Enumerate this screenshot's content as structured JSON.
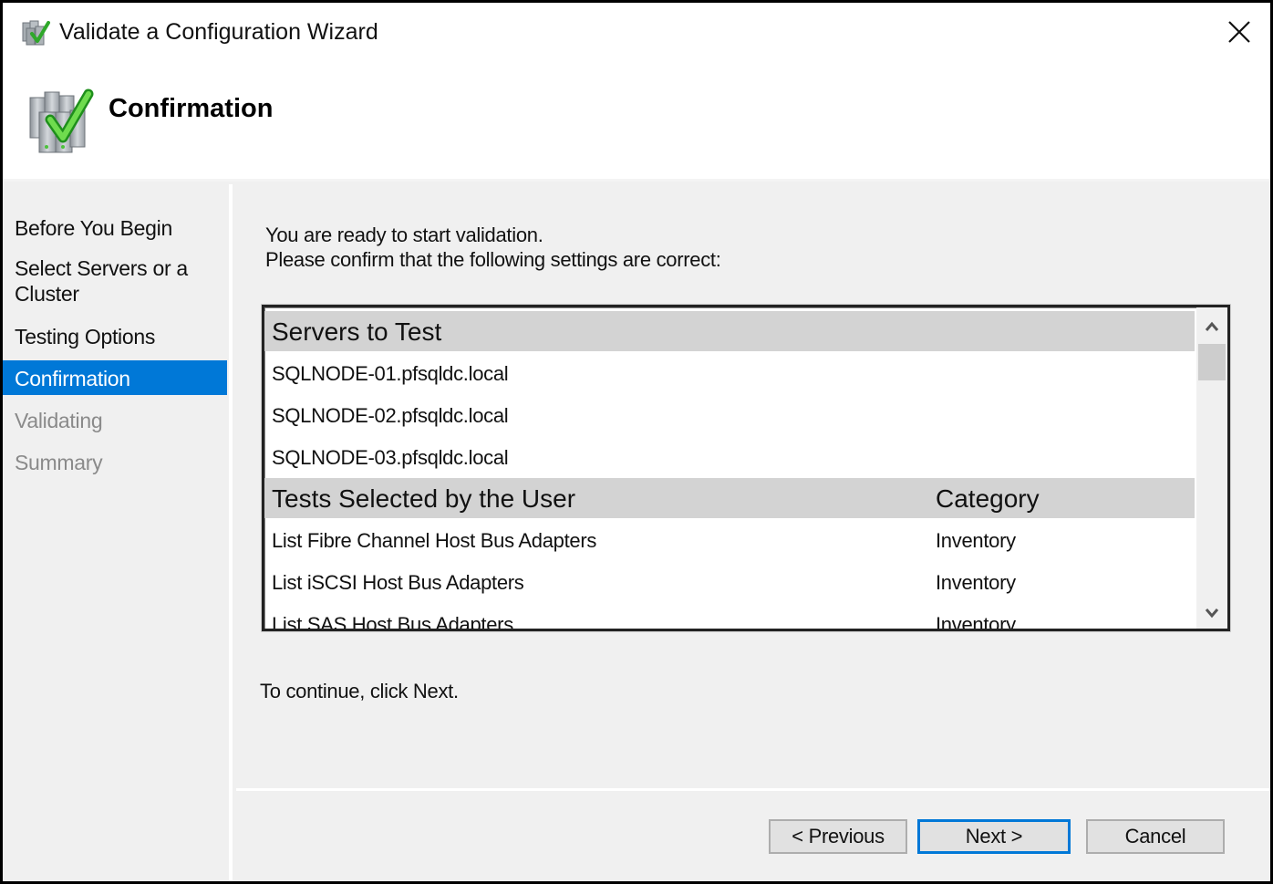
{
  "window": {
    "title": "Validate a Configuration Wizard",
    "icon": "validate-wizard-icon",
    "close_icon": "close-icon"
  },
  "header": {
    "title": "Confirmation",
    "icon": "servers-checkmark-icon"
  },
  "sidebar": {
    "items": [
      {
        "label": "Before You Begin",
        "state": "normal"
      },
      {
        "label": "Select Servers or a Cluster",
        "state": "normal"
      },
      {
        "label": "Testing Options",
        "state": "normal"
      },
      {
        "label": "Confirmation",
        "state": "active"
      },
      {
        "label": "Validating",
        "state": "disabled"
      },
      {
        "label": "Summary",
        "state": "disabled"
      }
    ],
    "active_color": "#0078d7"
  },
  "content": {
    "intro_line1": "You are ready to start validation.",
    "intro_line2": "Please confirm that the following settings are correct:",
    "servers_section": {
      "header": "Servers to Test",
      "items": [
        "SQLNODE-01.pfsqldc.local",
        "SQLNODE-02.pfsqldc.local",
        "SQLNODE-03.pfsqldc.local"
      ]
    },
    "tests_section": {
      "header": "Tests Selected by the User",
      "category_header": "Category",
      "items": [
        {
          "name": "List Fibre Channel Host Bus Adapters",
          "category": "Inventory"
        },
        {
          "name": "List iSCSI Host Bus Adapters",
          "category": "Inventory"
        },
        {
          "name": "List SAS Host Bus Adapters",
          "category": "Inventory"
        }
      ]
    },
    "continue_text": "To continue, click Next."
  },
  "footer": {
    "previous_label": "< Previous",
    "next_label": "Next >",
    "cancel_label": "Cancel"
  }
}
